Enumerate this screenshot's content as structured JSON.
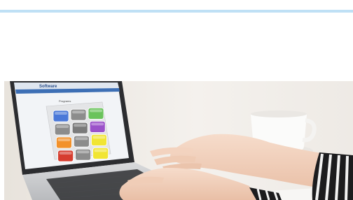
{
  "header": {
    "accent_color": "#bfe0f5"
  },
  "photo": {
    "subject": "person typing on a laptop showing a grid of colored app tiles",
    "screen": {
      "title": "Software",
      "heading": "Programs",
      "tiles": [
        {
          "color": "#4a78d8"
        },
        {
          "color": "#8c8c8c"
        },
        {
          "color": "#6ac35c"
        },
        {
          "color": "#8c8c8c"
        },
        {
          "color": "#7a7a7a"
        },
        {
          "color": "#9b52c9"
        },
        {
          "color": "#f2912b"
        },
        {
          "color": "#8c8c8c"
        },
        {
          "color": "#f1e533"
        },
        {
          "color": "#d63d2f"
        },
        {
          "color": "#8c8c8c"
        },
        {
          "color": "#f1e533"
        }
      ]
    }
  }
}
